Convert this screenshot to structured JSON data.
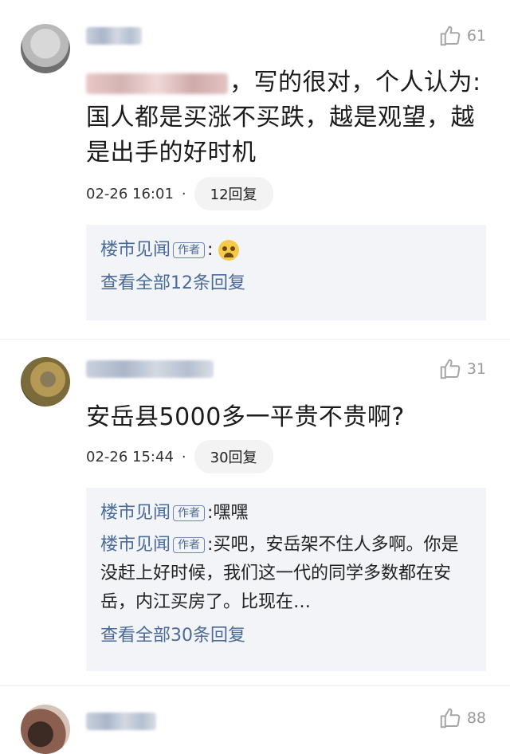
{
  "comments": [
    {
      "likes": "61",
      "content_text": "，写的很对，个人认为:国人都是买涨不买跌，越是观望，越是出手的好时机",
      "timestamp": "02-26 16:01",
      "separator": "·",
      "reply_count_label": "12回复",
      "replies": [
        {
          "author": "楼市见闻",
          "tag": "作者",
          "colon": ":",
          "text": ""
        }
      ],
      "view_all_label": "查看全部12条回复"
    },
    {
      "likes": "31",
      "content_text": "安岳县5000多一平贵不贵啊?",
      "timestamp": "02-26 15:44",
      "separator": "·",
      "reply_count_label": "30回复",
      "replies": [
        {
          "author": "楼市见闻",
          "tag": "作者",
          "colon": ":",
          "text": "嘿嘿"
        },
        {
          "author": "楼市见闻",
          "tag": "作者",
          "colon": ":",
          "text": "买吧，安岳架不住人多啊。你是没赶上好时候，我们这一代的同学多数都在安岳，内江买房了。比现在…"
        }
      ],
      "view_all_label": "查看全部30条回复"
    },
    {
      "likes": "88"
    }
  ],
  "icons": {
    "like": "thumbs-up-icon",
    "emoji": "crying-face-emoji"
  },
  "colors": {
    "author_link": "#4a6a9a",
    "like_gray": "#9a9a9a",
    "reply_box_bg": "#f2f4f7"
  }
}
